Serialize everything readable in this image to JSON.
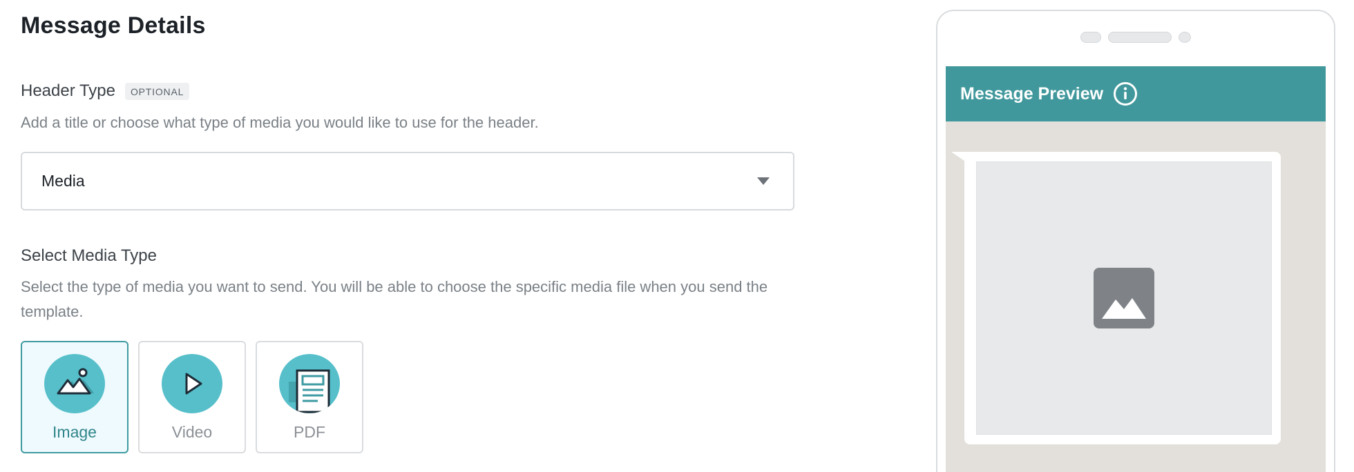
{
  "page": {
    "title": "Message Details"
  },
  "header_type": {
    "label": "Header Type",
    "badge": "OPTIONAL",
    "help": "Add a title or choose what type of media you would like to use for the header.",
    "selected": "Media"
  },
  "media_type": {
    "label": "Select Media Type",
    "help": "Select the type of media you want to send. You will be able to choose the specific media file when you send the template.",
    "options": [
      {
        "label": "Image",
        "icon": "image-icon",
        "selected": true
      },
      {
        "label": "Video",
        "icon": "play-icon",
        "selected": false
      },
      {
        "label": "PDF",
        "icon": "document-icon",
        "selected": false
      }
    ]
  },
  "preview": {
    "title": "Message Preview",
    "info_icon": "info-icon",
    "placeholder_icon": "image-placeholder-icon"
  },
  "colors": {
    "accent": "#41989c",
    "icon_bg": "#56bfca",
    "selected_bg": "#eefafd",
    "chat_bg": "#e3dfdb"
  }
}
